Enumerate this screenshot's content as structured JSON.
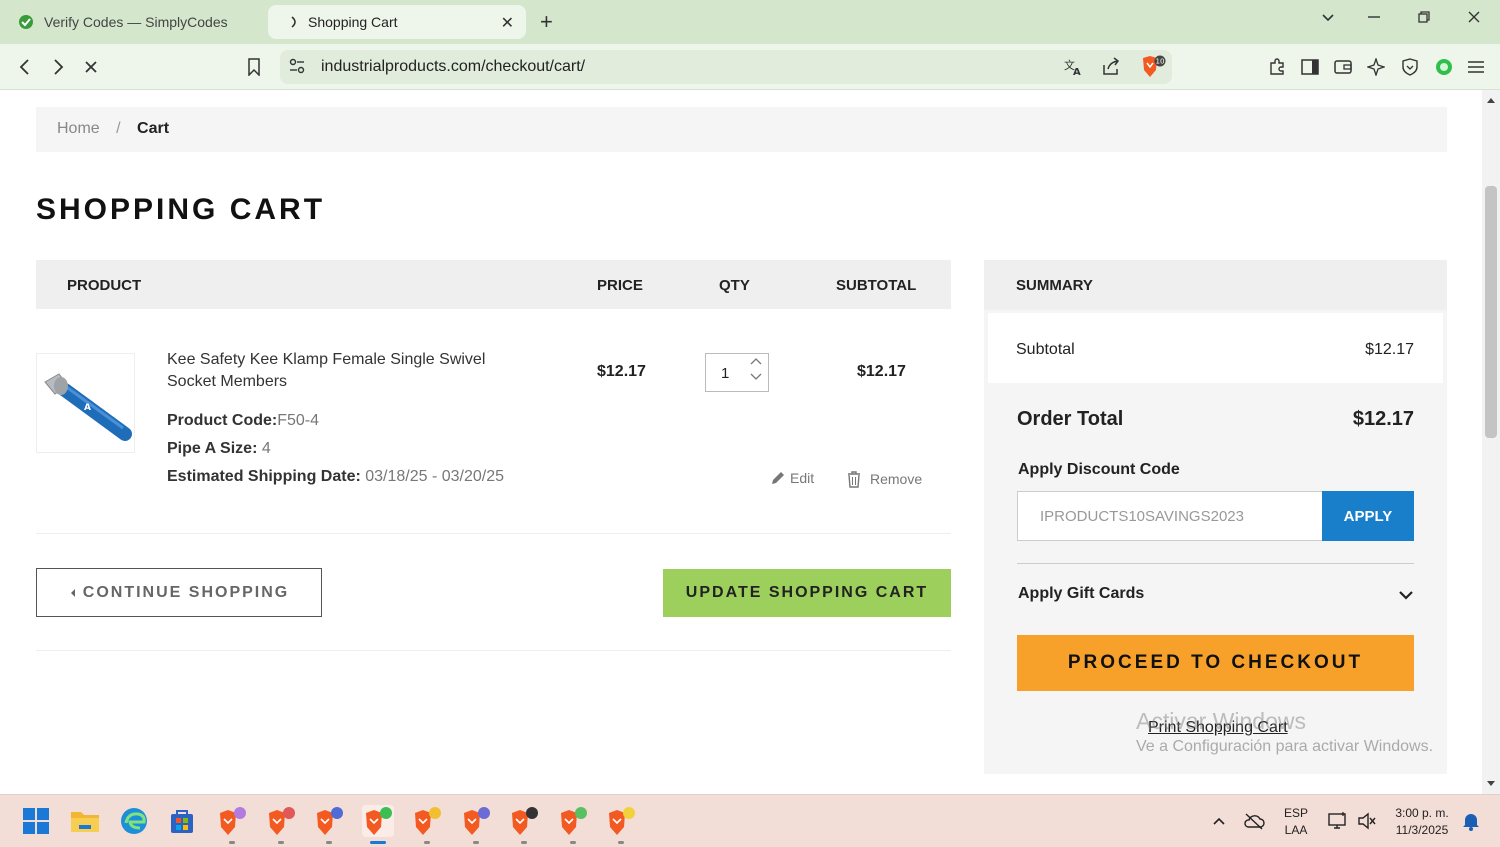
{
  "browser": {
    "tabs": [
      {
        "title": "Verify Codes — SimplyCodes",
        "active": false
      },
      {
        "title": "Shopping Cart",
        "active": true
      }
    ],
    "url": "industrialproducts.com/checkout/cart/",
    "brave_badge": "10"
  },
  "breadcrumb": {
    "home": "Home",
    "separator": "/",
    "current": "Cart"
  },
  "page_title": "SHOPPING CART",
  "cart_table": {
    "headers": {
      "product": "PRODUCT",
      "price": "PRICE",
      "qty": "QTY",
      "subtotal": "SUBTOTAL"
    },
    "items": [
      {
        "name": "Kee Safety Kee Klamp Female Single Swivel Socket Members",
        "product_code_label": "Product Code:",
        "product_code": "F50-4",
        "pipe_label": "Pipe A Size:",
        "pipe_value": "4",
        "shipping_label": "Estimated Shipping Date:",
        "shipping_value": "03/18/25 - 03/20/25",
        "price": "$12.17",
        "qty": "1",
        "subtotal": "$12.17",
        "edit_label": "Edit",
        "remove_label": "Remove"
      }
    ]
  },
  "actions": {
    "continue": "CONTINUE SHOPPING",
    "update": "UPDATE SHOPPING CART"
  },
  "summary": {
    "title": "SUMMARY",
    "subtotal_label": "Subtotal",
    "subtotal_value": "$12.17",
    "order_total_label": "Order Total",
    "order_total_value": "$12.17",
    "discount_label": "Apply Discount Code",
    "discount_value": "IPRODUCTS10SAVINGS2023",
    "apply_label": "APPLY",
    "gift_label": "Apply Gift Cards",
    "checkout_label": "PROCEED TO CHECKOUT",
    "print_label": "Print Shopping Cart"
  },
  "watermark": {
    "line1": "Activar Windows",
    "line2": "Ve a Configuración para activar Windows."
  },
  "taskbar": {
    "lang_top": "ESP",
    "lang_bottom": "LAA",
    "time": "3:00 p. m.",
    "date": "11/3/2025"
  },
  "colors": {
    "accent_blue": "#1a7fca",
    "checkout_orange": "#f7a12b",
    "update_green": "#9ccf5b",
    "tab_bar": "#d4e7cd"
  }
}
